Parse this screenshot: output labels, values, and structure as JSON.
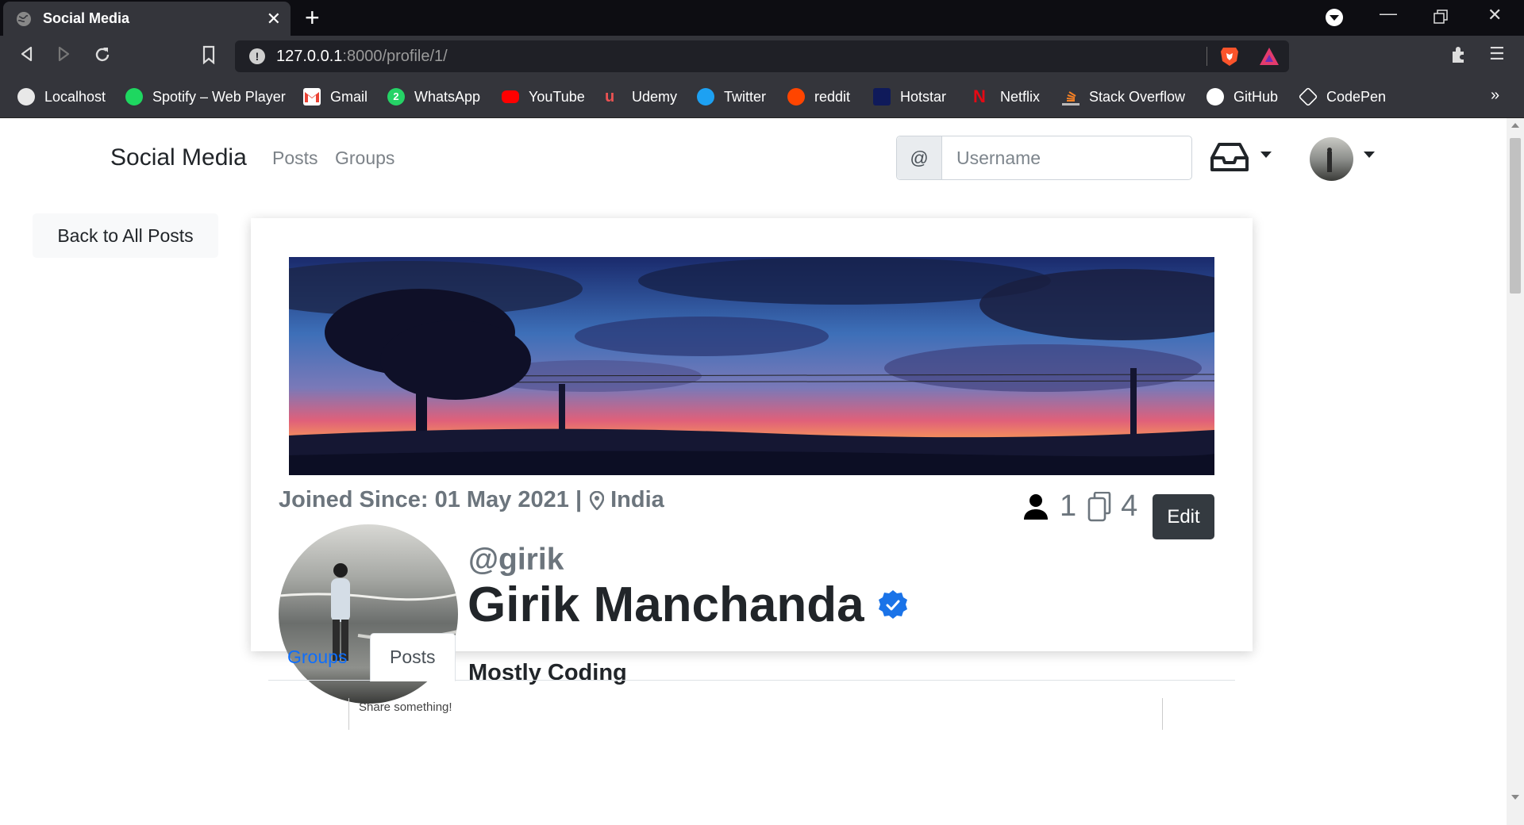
{
  "browser": {
    "tab_title": "Social Media",
    "url_host": "127.0.0.1",
    "url_path": ":8000/profile/1/",
    "bookmarks": [
      {
        "label": "Localhost",
        "icon": "globe-icon"
      },
      {
        "label": "Spotify – Web Player",
        "icon": "spotify-icon"
      },
      {
        "label": "Gmail",
        "icon": "gmail-icon"
      },
      {
        "label": "WhatsApp",
        "icon": "whatsapp-icon"
      },
      {
        "label": "YouTube",
        "icon": "youtube-icon"
      },
      {
        "label": "Udemy",
        "icon": "udemy-icon"
      },
      {
        "label": "Twitter",
        "icon": "twitter-icon"
      },
      {
        "label": "reddit",
        "icon": "reddit-icon"
      },
      {
        "label": "Hotstar",
        "icon": "hotstar-icon"
      },
      {
        "label": "Netflix",
        "icon": "netflix-icon"
      },
      {
        "label": "Stack Overflow",
        "icon": "stackoverflow-icon"
      },
      {
        "label": "GitHub",
        "icon": "github-icon"
      },
      {
        "label": "CodePen",
        "icon": "codepen-icon"
      }
    ],
    "bookmarks_more": "»"
  },
  "navbar": {
    "brand": "Social Media",
    "links": [
      "Posts",
      "Groups"
    ],
    "search_prefix": "@",
    "search_placeholder": "Username"
  },
  "back_button": "Back to All Posts",
  "profile": {
    "joined_label": "Joined Since: 01 May 2021 |",
    "location": "India",
    "followers_count": "1",
    "posts_count": "4",
    "edit_label": "Edit",
    "handle": "@girik",
    "name": "Girik Manchanda",
    "verified": true,
    "bio": "Mostly Coding"
  },
  "tabs": [
    "Groups",
    "Posts"
  ],
  "active_tab": "Posts",
  "share_placeholder": "Share something!",
  "colors": {
    "accent": "#0d6efd",
    "verified": "#1a73e8",
    "dark_button": "#343a40"
  }
}
